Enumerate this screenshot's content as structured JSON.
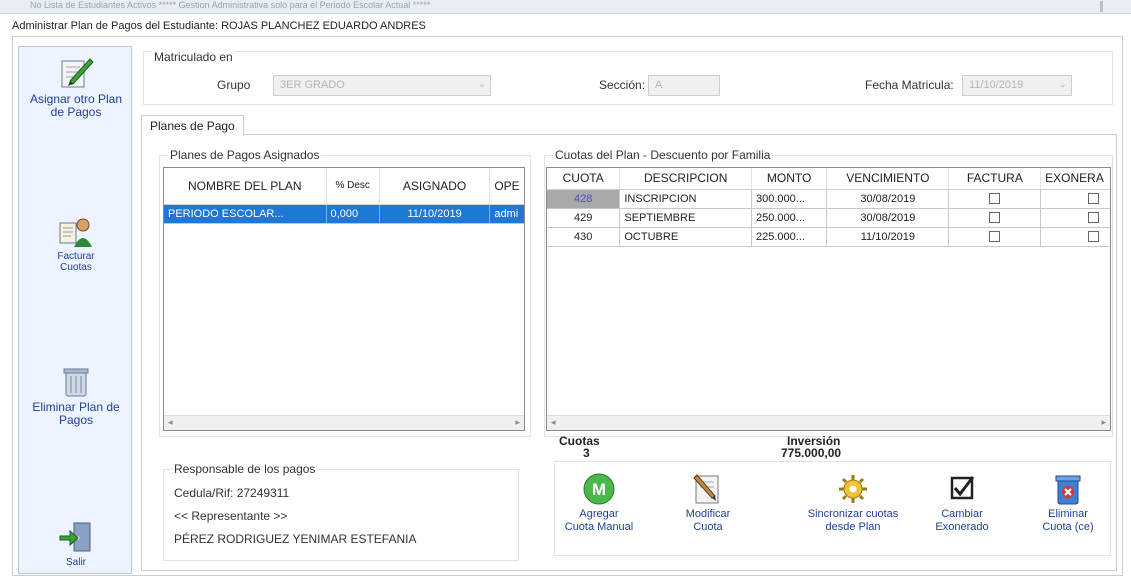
{
  "background_strip": {
    "text": "No  Lista de Estudiantes Activos     ***** Gestion Administrativa solo para el Periodo Escolar Actual *****"
  },
  "window": {
    "title": "Administrar Plan de Pagos del Estudiante: ROJAS PLANCHEZ EDUARDO ANDRES"
  },
  "sidebar": {
    "items": [
      {
        "label": "Asignar otro Plan de Pagos",
        "icon": "checklist-pen-icon"
      },
      {
        "label": "Facturar Cuotas",
        "icon": "student-invoice-icon"
      },
      {
        "label": "Eliminar Plan de Pagos",
        "icon": "trash-bin-icon"
      },
      {
        "label": "Salir",
        "icon": "exit-door-icon"
      }
    ]
  },
  "matricula": {
    "legend": "Matriculado en",
    "grupo_label": "Grupo",
    "grupo_value": "3ER GRADO",
    "seccion_label": "Sección:",
    "seccion_value": "A",
    "fecha_label": "Fecha Matricula:",
    "fecha_value": "11/10/2019"
  },
  "tabs": [
    {
      "label": "Planes de Pago"
    }
  ],
  "planes": {
    "legend": "Planes de Pagos Asignados",
    "columns": [
      "NOMBRE DEL PLAN",
      "% Desc",
      "ASIGNADO",
      "OPE"
    ],
    "rows": [
      {
        "nombre": "PERIODO ESCOLAR...",
        "desc": "0,000",
        "asignado": "11/10/2019",
        "ope": "admi"
      }
    ]
  },
  "cuotas": {
    "legend": "Cuotas del Plan - Descuento por Familia",
    "columns": [
      "CUOTA",
      "DESCRIPCION",
      "MONTO",
      "VENCIMIENTO",
      "FACTURA",
      "EXONERA"
    ],
    "rows": [
      {
        "cuota": "428",
        "descripcion": "INSCRIPCION",
        "monto": "300.000...",
        "vencimiento": "30/08/2019"
      },
      {
        "cuota": "429",
        "descripcion": "SEPTIEMBRE",
        "monto": "250.000...",
        "vencimiento": "30/08/2019"
      },
      {
        "cuota": "430",
        "descripcion": "OCTUBRE",
        "monto": "225.000...",
        "vencimiento": "11/10/2019"
      }
    ]
  },
  "summary": {
    "cuotas_label": "Cuotas",
    "cuotas_value": "3",
    "inversion_label": "Inversión",
    "inversion_value": "775.000,00"
  },
  "responsable": {
    "legend": "Responsable de los pagos",
    "cedula": "Cedula/Rif: 27249311",
    "tipo": "<< Representante >>",
    "nombre": "PÉREZ RODRIGUEZ YENIMAR ESTEFANIA"
  },
  "actions": [
    {
      "label1": "Agregar",
      "label2": "Cuota Manual",
      "icon": "green-m-icon"
    },
    {
      "label1": "Modificar",
      "label2": "Cuota",
      "icon": "pencil-paper-icon"
    },
    {
      "label1": "Sincronizar cuotas",
      "label2": "desde Plan",
      "icon": "gear-sync-icon"
    },
    {
      "label1": "Cambiar",
      "label2": "Exonerado",
      "icon": "checkbox-icon"
    },
    {
      "label1": "Eliminar",
      "label2": "Cuota (ce)",
      "icon": "delete-cuota-icon"
    }
  ]
}
